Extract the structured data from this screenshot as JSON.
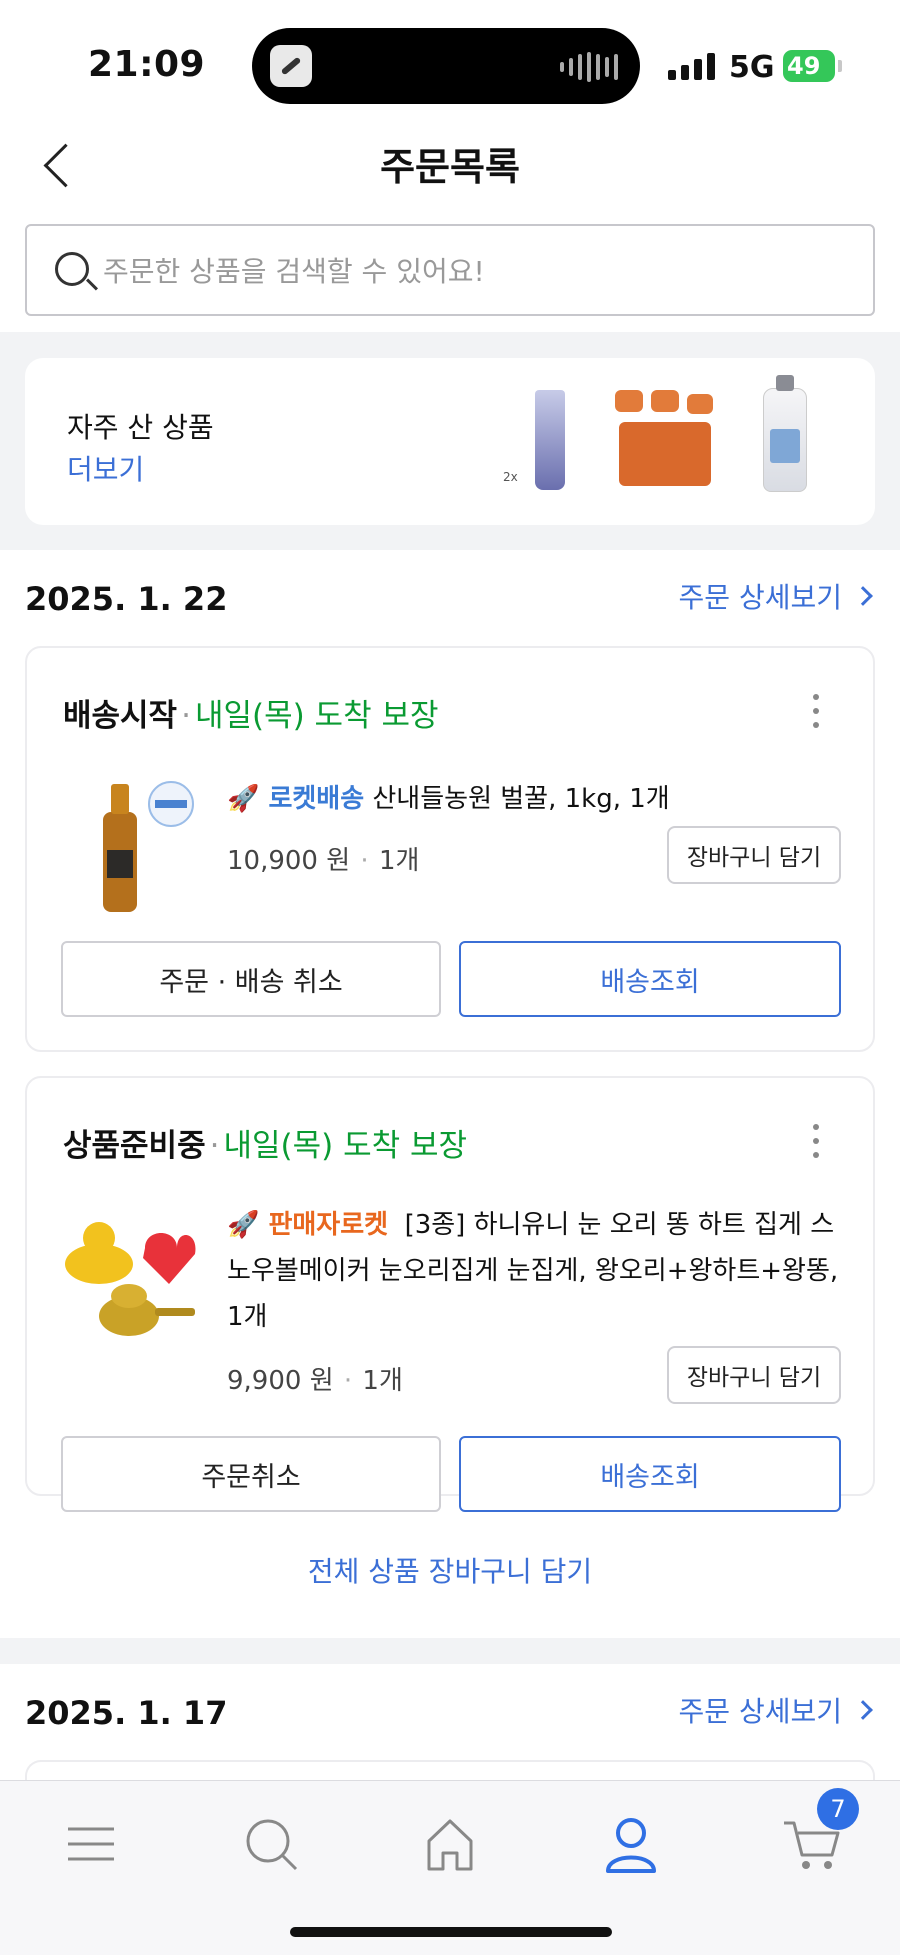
{
  "status_bar": {
    "time": "21:09",
    "network": "5G",
    "battery": "49"
  },
  "header": {
    "title": "주문목록"
  },
  "search": {
    "placeholder": "주문한 상품을 검색할 수 있어요!"
  },
  "frequent": {
    "label": "자주 산 상품",
    "more": "더보기",
    "tube_badge": "2x"
  },
  "orders": [
    {
      "date": "2025. 1. 22",
      "detail_label": "주문 상세보기",
      "items": [
        {
          "status": "배송시작",
          "sep": "·",
          "delivery": "내일(목) 도착 보장",
          "badge": "로켓배송",
          "name": "산내들농원 벌꿀, 1kg, 1개",
          "price": "10,900 원",
          "qty": "1개",
          "cart_label": "장바구니 담기",
          "left_button": "주문 · 배송 취소",
          "right_button": "배송조회"
        },
        {
          "status": "상품준비중",
          "sep": "·",
          "delivery": "내일(목) 도착 보장",
          "badge": "판매자로켓",
          "name_line1": "[3종] 하니유니 눈 오리 똥 하트 집게 스",
          "name_line2": "노우볼메이커 눈오리집게 눈집게, 왕오리+왕하트+왕똥,",
          "name_line3": "1개",
          "price": "9,900 원",
          "qty": "1개",
          "cart_label": "장바구니 담기",
          "left_button": "주문취소",
          "right_button": "배송조회"
        }
      ],
      "all_cart_label": "전체 상품 장바구니 담기"
    },
    {
      "date": "2025. 1. 17",
      "detail_label": "주문 상세보기"
    }
  ],
  "tabbar": {
    "cart_count": "7",
    "icons": [
      "menu-icon",
      "search-icon",
      "home-icon",
      "my-account-icon",
      "cart-icon"
    ],
    "active_color": "#2f6fe4"
  },
  "colors": {
    "accent": "#3b6fd6",
    "green": "#0a9a32",
    "rocket": "#3a7bd5",
    "seller": "#e8671e"
  }
}
